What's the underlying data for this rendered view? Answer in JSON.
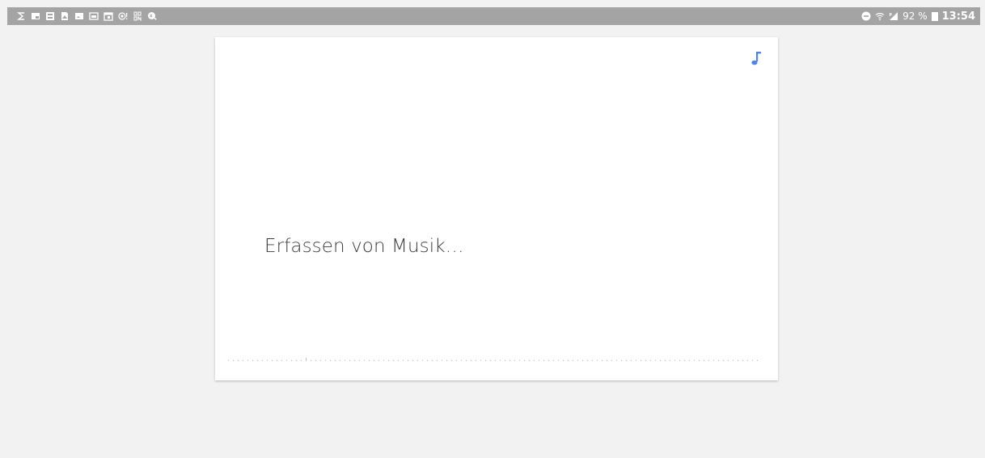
{
  "status_bar": {
    "left_icons": [
      "s-logo-icon",
      "screen-cast-icon",
      "gallery-icon",
      "document-icon",
      "image-icon",
      "image-folder-icon",
      "calendar-icon",
      "nfc-alert-icon",
      "sp-on-icon",
      "xl-search-icon"
    ],
    "right": {
      "battery_text": "92 %",
      "time": "13:54"
    }
  },
  "card": {
    "status_text": "Erfassen von Musik…",
    "icon": "music-note-icon",
    "accent_color": "#4a86e8"
  }
}
